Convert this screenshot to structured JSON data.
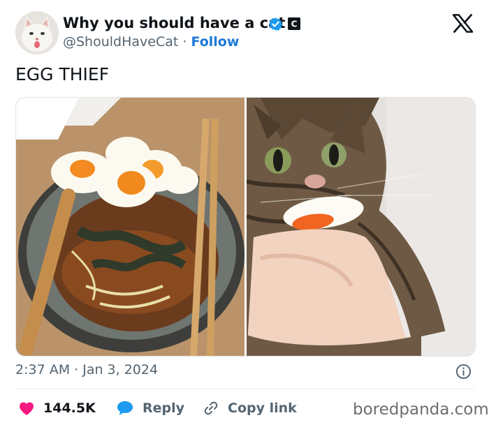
{
  "author": {
    "display_name": "Why you should have a cat",
    "handle": "@ShouldHaveCat",
    "separator": "·",
    "follow_label": "Follow",
    "badge_letter": "C"
  },
  "tweet": {
    "text": "EGG THIEF",
    "timestamp": "2:37 AM · Jan 3, 2024"
  },
  "actions": {
    "likes": "144.5K",
    "reply": "Reply",
    "copy_link": "Copy link"
  },
  "icons": [
    "cat-avatar-icon",
    "verified-icon",
    "brand-badge-icon",
    "x-logo-icon",
    "info-icon",
    "heart-icon",
    "reply-bubble-icon",
    "link-icon"
  ],
  "colors": {
    "verified": "#1d9bf0",
    "follow": "#1d7ad6",
    "heart": "#f91880",
    "reply_icon": "#1d9bf0",
    "secondary_text": "#536471"
  },
  "watermark": "boredpanda.com"
}
